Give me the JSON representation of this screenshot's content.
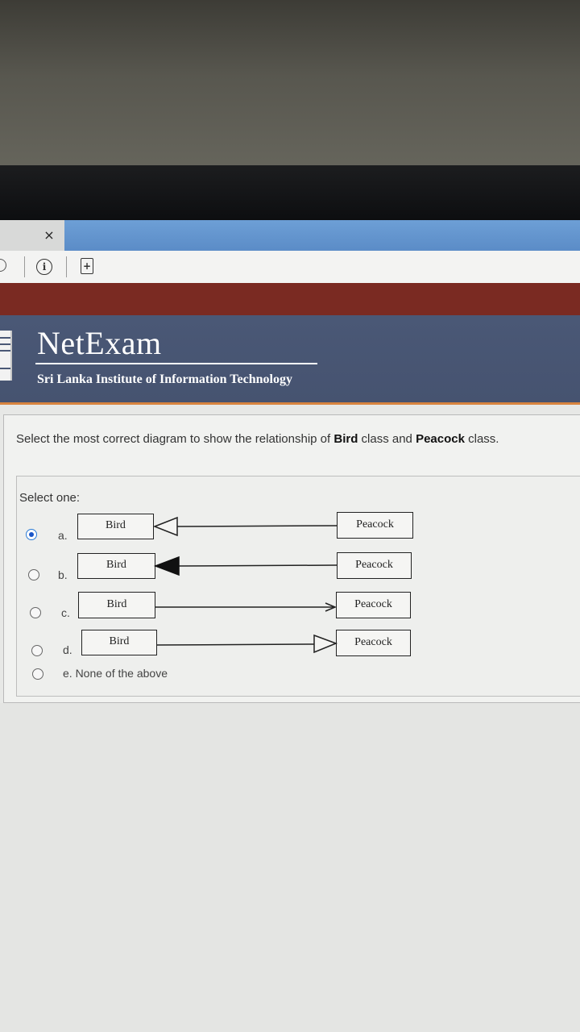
{
  "browser": {
    "tab_close_glyph": "×",
    "info_glyph": "i",
    "page_glyph": "+"
  },
  "banner": {
    "brand": "NetExam",
    "institute": "Sri Lanka Institute of Information Technology"
  },
  "question": {
    "prefix": "Select the most correct diagram to show the relationship of ",
    "class_a": "Bird",
    "middle": " class and ",
    "class_b": "Peacock",
    "suffix": " class."
  },
  "answer": {
    "prompt": "Select one:",
    "selected": "a",
    "options": [
      {
        "letter": "a.",
        "left_box": "Bird",
        "right_box": "Peacock",
        "arrow": "hollow-triangle-pointing-left"
      },
      {
        "letter": "b.",
        "left_box": "Bird",
        "right_box": "Peacock",
        "arrow": "filled-triangle-pointing-left"
      },
      {
        "letter": "c.",
        "left_box": "Bird",
        "right_box": "Peacock",
        "arrow": "open-arrow-pointing-right"
      },
      {
        "letter": "d.",
        "left_box": "Bird",
        "right_box": "Peacock",
        "arrow": "hollow-triangle-pointing-right"
      },
      {
        "letter": "e. None of the above"
      }
    ]
  },
  "colors": {
    "banner": "#4a5876",
    "maroon_bar": "#7a2a22",
    "accent_rule": "#d8843f",
    "tab_blue": "#5b8cc7",
    "radio_selected": "#1a56c8"
  }
}
